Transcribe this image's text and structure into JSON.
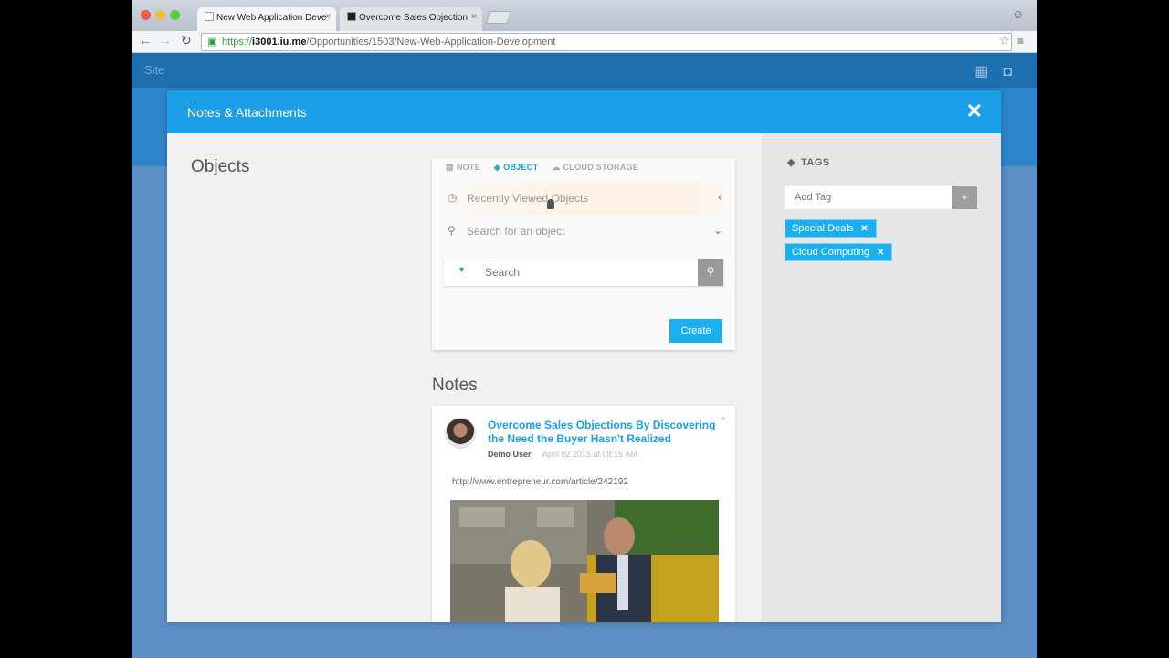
{
  "browser": {
    "tabs": [
      {
        "title": "New Web Application Deve"
      },
      {
        "title": "Overcome Sales Objection"
      }
    ],
    "url": {
      "scheme": "https://",
      "host": "i3001.iu.me",
      "path": "/Opportunities/1503/New-Web-Application-Development"
    }
  },
  "app": {
    "logo": "Site"
  },
  "modal": {
    "title": "Notes & Attachments",
    "objects_heading": "Objects",
    "object_panel": {
      "tabs": [
        {
          "label": "NOTE",
          "icon": "note-icon",
          "active": false
        },
        {
          "label": "OBJECT",
          "icon": "cube-icon",
          "active": true
        },
        {
          "label": "CLOUD STORAGE",
          "icon": "cloud-icon",
          "active": false
        }
      ],
      "recent_label": "Recently Viewed Objects",
      "search_object_label": "Search for an object",
      "search_placeholder": "Search",
      "create_label": "Create"
    },
    "notes_heading": "Notes",
    "note": {
      "title": "Overcome Sales Objections By Discovering the Need the Buyer Hasn't Realized",
      "author": "Demo User",
      "date": "April 02 2015 at 08:16 AM",
      "url": "http://www.entrepreneur.com/article/242192"
    },
    "tags": {
      "label": "TAGS",
      "add_placeholder": "Add Tag",
      "add_button": "+",
      "items": [
        {
          "label": "Special Deals"
        },
        {
          "label": "Cloud Computing"
        }
      ]
    }
  },
  "colors": {
    "accent": "#1a9ee5",
    "tag": "#1ab0ef",
    "header": "#1a9ee5"
  }
}
